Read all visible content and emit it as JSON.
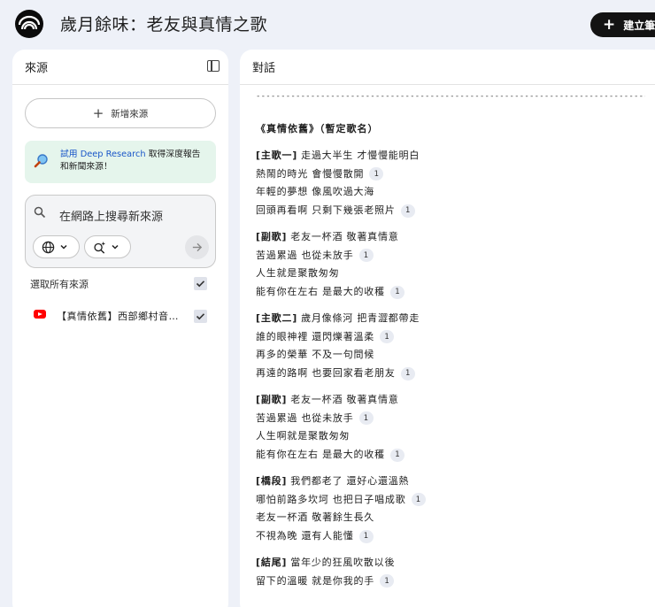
{
  "header": {
    "title": "歲月餘味：老友與真情之歌",
    "create_label": "建立筆"
  },
  "sources": {
    "panel_title": "來源",
    "add_label": "新增來源",
    "promo_link": "試用 Deep Research",
    "promo_text_1": " 取得深度報告",
    "promo_text_2": "和新聞來源！",
    "search_placeholder": "在網路上搜尋新來源",
    "select_all_label": "選取所有來源",
    "items": [
      {
        "title": "【真情依舊】西部鄉村音樂...",
        "checked": true
      }
    ]
  },
  "chat": {
    "panel_title": "對話",
    "divider": "--------------------------------------------------------------------------------------------------------",
    "song_title": "《真情依舊》（暫定歌名）",
    "sections": [
      {
        "label": "[主歌一]",
        "lines": [
          {
            "text": "走過大半生 才慢慢能明白",
            "cite": ""
          },
          {
            "text": "熱鬧的時光 會慢慢散開",
            "cite": "1"
          },
          {
            "text": "年輕的夢想 像風吹過大海",
            "cite": ""
          },
          {
            "text": "回頭再看啊 只剩下幾張老照片",
            "cite": "1"
          }
        ]
      },
      {
        "label": "[副歌]",
        "lines": [
          {
            "text": "老友一杯酒 敬著真情意",
            "cite": ""
          },
          {
            "text": "苦過累過 也從未放手",
            "cite": "1"
          },
          {
            "text": "人生就是聚散匆匆",
            "cite": ""
          },
          {
            "text": "能有你在左右 是最大的收穫",
            "cite": "1"
          }
        ]
      },
      {
        "label": "[主歌二]",
        "lines": [
          {
            "text": "歲月像條河 把青澀都帶走",
            "cite": ""
          },
          {
            "text": "誰的眼神裡 還閃爍著溫柔",
            "cite": "1"
          },
          {
            "text": "再多的榮華 不及一句問候",
            "cite": ""
          },
          {
            "text": "再遠的路啊 也要回家看老朋友",
            "cite": "1"
          }
        ]
      },
      {
        "label": "[副歌]",
        "lines": [
          {
            "text": "老友一杯酒 敬著真情意",
            "cite": ""
          },
          {
            "text": "苦過累過 也從未放手",
            "cite": "1"
          },
          {
            "text": "人生啊就是聚散匆匆",
            "cite": ""
          },
          {
            "text": "能有你在左右 是最大的收穫",
            "cite": "1"
          }
        ]
      },
      {
        "label": "[橋段]",
        "lines": [
          {
            "text": "我們都老了 還好心還溫熱",
            "cite": ""
          },
          {
            "text": "哪怕前路多坎坷 也把日子唱成歌",
            "cite": "1"
          },
          {
            "text": "老友一杯酒 敬著餘生長久",
            "cite": ""
          },
          {
            "text": "不視為晚 還有人能懂",
            "cite": "1"
          }
        ]
      },
      {
        "label": "[結尾]",
        "lines": [
          {
            "text": "當年少的狂風吹散以後",
            "cite": ""
          },
          {
            "text": "留下的溫暖 就是你我的手",
            "cite": "1"
          }
        ]
      }
    ]
  }
}
